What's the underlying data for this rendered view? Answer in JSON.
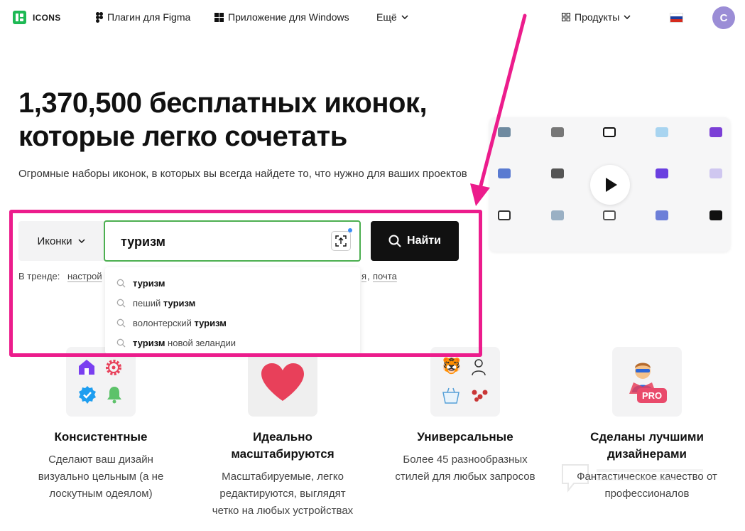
{
  "header": {
    "logo_text": "ICONS",
    "nav": {
      "figma_plugin": "Плагин для Figma",
      "windows_app": "Приложение для Windows",
      "more": "Ещё",
      "products": "Продукты"
    },
    "avatar_letter": "С",
    "flag_colors": [
      "#ffffff",
      "#1c3fa0",
      "#d52b1e"
    ]
  },
  "hero": {
    "title_line1": "1,370,500 бесплатных иконок,",
    "title_line2": "которые легко сочетать",
    "subtitle": "Огромные наборы иконок, в которых вы всегда найдете то, что нужно для ваших проектов"
  },
  "search": {
    "scope_label": "Иконки",
    "value": "туризм",
    "find_label": "Найти",
    "trending_label": "В тренде:",
    "trending_visible_start": "настрой",
    "trending_visible_mid": "я",
    "trending_visible_end": "почта",
    "suggestions": [
      {
        "pre": "",
        "bold": "туризм",
        "post": ""
      },
      {
        "pre": "пеший ",
        "bold": "туризм",
        "post": ""
      },
      {
        "pre": "волонтерский ",
        "bold": "туризм",
        "post": ""
      },
      {
        "pre": "",
        "bold": "туризм",
        "post": " новой зеландии"
      }
    ]
  },
  "features": [
    {
      "title": "Консистентные",
      "desc_lines": [
        "Сделают ваш дизайн",
        "визуально цельным (а не",
        "лоскутным одеялом)"
      ]
    },
    {
      "title_lines": [
        "Идеально",
        "масштабируются"
      ],
      "desc_lines": [
        "Масштабируемые, легко",
        "редактируются, выглядят",
        "четко на любых устройствах"
      ]
    },
    {
      "title": "Универсальные",
      "desc_lines": [
        "Более 45 разнообразных",
        "стилей для любых запросов"
      ]
    },
    {
      "title_lines": [
        "Сделаны лучшими",
        "дизайнерами"
      ],
      "desc_lines": [
        "Фантастическое качество от",
        "профессионалов"
      ]
    }
  ],
  "pro_badge": "PRO",
  "colors": {
    "accent_annotation": "#ec1c8c",
    "input_border": "#4caf50",
    "find_button": "#111111",
    "heart": "#e8405a"
  }
}
